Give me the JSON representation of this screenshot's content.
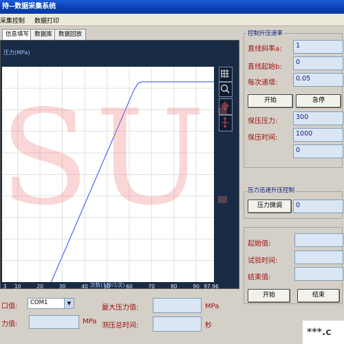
{
  "window": {
    "title": "持--数据采集系统"
  },
  "menu": {
    "items": [
      "采集控制",
      "数据打印"
    ]
  },
  "tabs": [
    "信息填写",
    "数据库",
    "数据回放"
  ],
  "colors": {
    "plot_line": "#5a6cff",
    "grid": "#e0e0e0",
    "plot_bg": "#ffffff",
    "label_red": "#a01010",
    "group_title": "#10217a"
  },
  "chart": {
    "ylabel": "压力(MPa)",
    "xlabel": "次数(1秒/1次)",
    "x_ticks": [
      "3",
      "10",
      "20",
      "30",
      "40",
      "50",
      "60",
      "70",
      "80",
      "90",
      "97.96"
    ],
    "toolbar_icons": [
      "grid-icon",
      "zoom-icon",
      "cursor-icon",
      "pan-icon"
    ]
  },
  "chart_data": {
    "type": "line",
    "xlabel": "次数(1秒/1次)",
    "ylabel": "压力(MPa)",
    "x_ticks": [
      "3",
      "10",
      "20",
      "30",
      "40",
      "50",
      "60",
      "70",
      "80",
      "90",
      "97.96"
    ],
    "xlim": [
      3,
      97.96
    ],
    "ylim": [
      0,
      1
    ],
    "grid": true,
    "series": [
      {
        "points": [
          [
            25,
            0.0
          ],
          [
            62,
            0.89
          ],
          [
            64,
            0.925
          ],
          [
            66,
            0.93
          ],
          [
            97.96,
            0.93
          ]
        ]
      }
    ]
  },
  "right": {
    "speed_group": {
      "title": "控制升压速率",
      "slope_label": "直线斜率a:",
      "slope_value": "1",
      "start_label": "直线起始b:",
      "start_value": "0",
      "step_label": "每次递增:",
      "step_value": "0.05",
      "start_button": "开始",
      "stop_button": "急停",
      "hold_pressure_label": "保压压力:",
      "hold_pressure_value": "300",
      "hold_time_label": "保压时间:",
      "hold_time_value": "1000",
      "extra_value": "0"
    },
    "fast_group": {
      "title": "压力迅速升压控制",
      "adjust_button": "压力微调",
      "adjust_value": "0"
    },
    "result_group": {
      "start_label": "起始值:",
      "start_value": "",
      "time_label": "试验时间:",
      "time_value": "",
      "end_label": "结束值:",
      "end_value": "",
      "start_button": "开始",
      "end_button": "结束"
    }
  },
  "bottom": {
    "port_label": "口值:",
    "port_value": "COM1",
    "pressure_label": "力值:",
    "pressure_value": "",
    "pressure_unit": "MPa",
    "max_pressure_label": "最大压力值:",
    "max_pressure_value": "",
    "max_pressure_unit": "MPa",
    "total_time_label": "测压总时间:",
    "total_time_value": "",
    "total_time_unit": "秒"
  },
  "watermark": {
    "text": "SUP",
    "corner_text": "***.c"
  }
}
